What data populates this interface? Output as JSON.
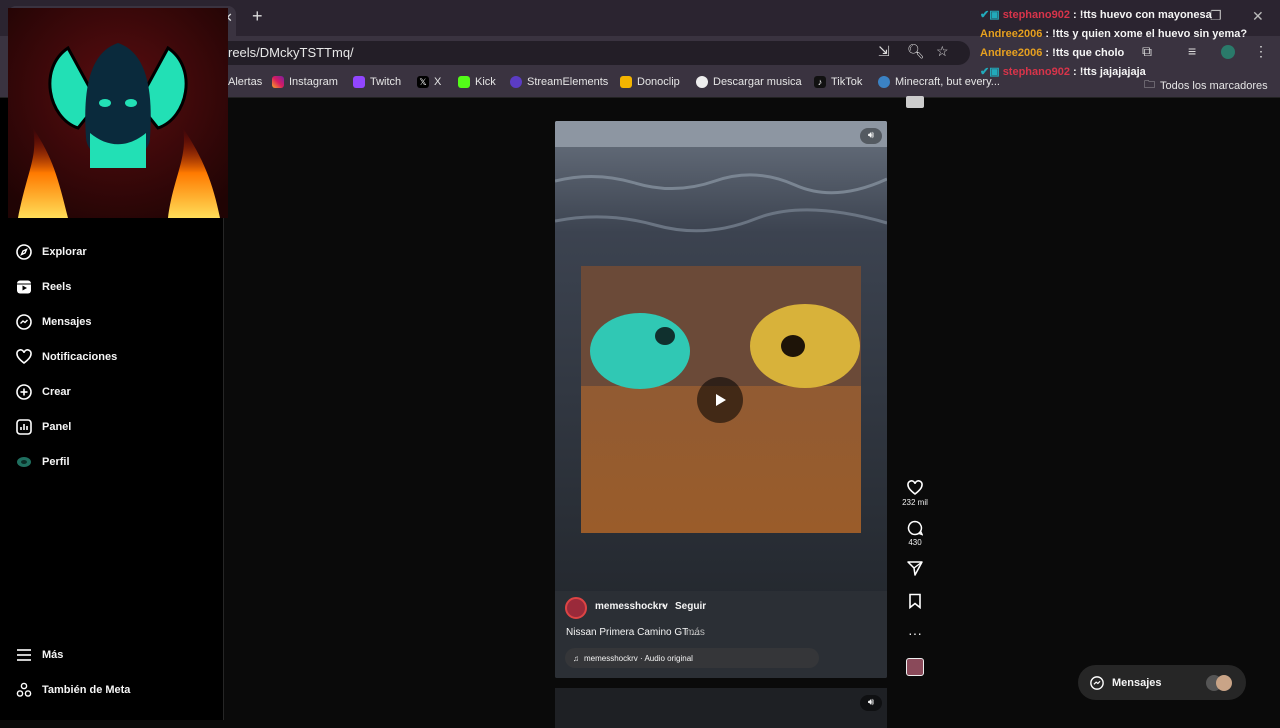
{
  "browser": {
    "url": "reels/DMckyTSTTmq/",
    "bookmarks": [
      "Alertas",
      "Instagram",
      "Twitch",
      "X",
      "Kick",
      "StreamElements",
      "Donoclip",
      "Descargar musica",
      "TikTok",
      "Minecraft, but every...",
      "Todos los marcadores"
    ]
  },
  "chat": {
    "messages": [
      {
        "user": "stephano902",
        "text": " : !tts huevo con mayonesa",
        "color": "#d8344a"
      },
      {
        "user": "Andree2006",
        "text": " : !tts y quien xome el huevo sin yema?",
        "color": "#e6a020"
      },
      {
        "user": "Andree2006",
        "text": " : !tts que cholo",
        "color": "#e6a020"
      },
      {
        "user": "stephano902",
        "text": " : !tts jajajajaja",
        "color": "#d8344a"
      }
    ]
  },
  "sidebar": {
    "items": [
      {
        "label": "Explorar",
        "icon": "compass-icon"
      },
      {
        "label": "Reels",
        "icon": "reels-icon"
      },
      {
        "label": "Mensajes",
        "icon": "messenger-icon"
      },
      {
        "label": "Notificaciones",
        "icon": "heart-icon"
      },
      {
        "label": "Crear",
        "icon": "plus-square-icon"
      },
      {
        "label": "Panel",
        "icon": "chart-icon"
      },
      {
        "label": "Perfil",
        "icon": "profile-avatar-icon"
      }
    ],
    "more": "Más",
    "meta": "También de Meta"
  },
  "reel": {
    "username": "memesshockrv",
    "follow": "Seguir",
    "caption": "Nissan Primera Camino GT ...",
    "more": "más",
    "audio": "memesshockrv · Audio original"
  },
  "actions": {
    "likes": "232 mil",
    "comments": "430"
  },
  "messages_pill": "Mensajes",
  "colors": {
    "accent": "#0095f6"
  }
}
